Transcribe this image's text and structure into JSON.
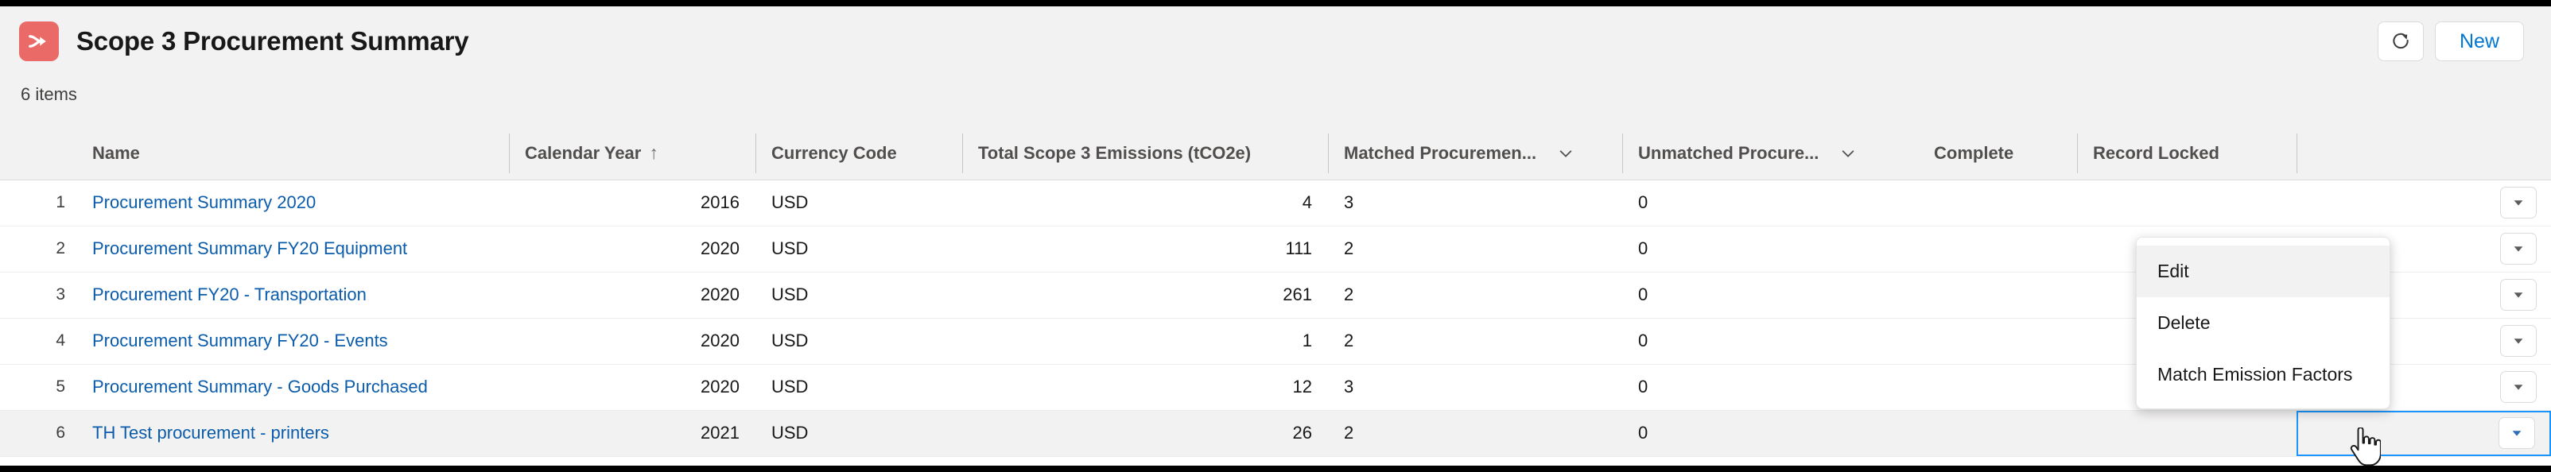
{
  "header": {
    "app_icon": "merge-arrow-icon",
    "icon_color": "#ea6a68",
    "title": "Scope 3 Procurement Summary",
    "refresh_label": "refresh-icon",
    "new_label": "New",
    "new_color": "#0176d3"
  },
  "list": {
    "item_count": "6 items"
  },
  "table": {
    "columns": [
      {
        "key": "rownum",
        "label": ""
      },
      {
        "key": "name",
        "label": "Name"
      },
      {
        "key": "year",
        "label": "Calendar Year",
        "sort": "↑"
      },
      {
        "key": "currency",
        "label": "Currency Code"
      },
      {
        "key": "emissions",
        "label": "Total Scope 3 Emissions (tCO2e)"
      },
      {
        "key": "matched",
        "label": "Matched Procuremen...",
        "menu": true
      },
      {
        "key": "unmatched",
        "label": "Unmatched Procure...",
        "menu": true
      },
      {
        "key": "complete",
        "label": "Complete"
      },
      {
        "key": "locked",
        "label": "Record Locked"
      },
      {
        "key": "actions",
        "label": ""
      }
    ],
    "rows": [
      {
        "rownum": "1",
        "name": "Procurement Summary 2020",
        "year": "2016",
        "currency": "USD",
        "emissions": "4",
        "matched": "3",
        "unmatched": "0",
        "complete": "",
        "locked": "",
        "selected": false
      },
      {
        "rownum": "2",
        "name": "Procurement Summary FY20 Equipment",
        "year": "2020",
        "currency": "USD",
        "emissions": "111",
        "matched": "2",
        "unmatched": "0",
        "complete": "",
        "locked": "",
        "selected": false
      },
      {
        "rownum": "3",
        "name": "Procurement FY20 - Transportation",
        "year": "2020",
        "currency": "USD",
        "emissions": "261",
        "matched": "2",
        "unmatched": "0",
        "complete": "",
        "locked": "",
        "selected": false
      },
      {
        "rownum": "4",
        "name": "Procurement Summary FY20 - Events",
        "year": "2020",
        "currency": "USD",
        "emissions": "1",
        "matched": "2",
        "unmatched": "0",
        "complete": "",
        "locked": "",
        "selected": false
      },
      {
        "rownum": "5",
        "name": "Procurement Summary - Goods Purchased",
        "year": "2020",
        "currency": "USD",
        "emissions": "12",
        "matched": "3",
        "unmatched": "0",
        "complete": "",
        "locked": "",
        "selected": false
      },
      {
        "rownum": "6",
        "name": "TH Test procurement - printers",
        "year": "2021",
        "currency": "USD",
        "emissions": "26",
        "matched": "2",
        "unmatched": "0",
        "complete": "",
        "locked": "",
        "selected": true
      }
    ]
  },
  "dropdown": {
    "open": true,
    "items": [
      {
        "label": "Edit",
        "active": true
      },
      {
        "label": "Delete",
        "active": false
      },
      {
        "label": "Match Emission Factors",
        "active": false
      }
    ]
  },
  "colors": {
    "link": "#0b5cab",
    "accent": "#0176d3",
    "focus_border": "#1b96ff",
    "page_bg": "#f3f2f2"
  }
}
